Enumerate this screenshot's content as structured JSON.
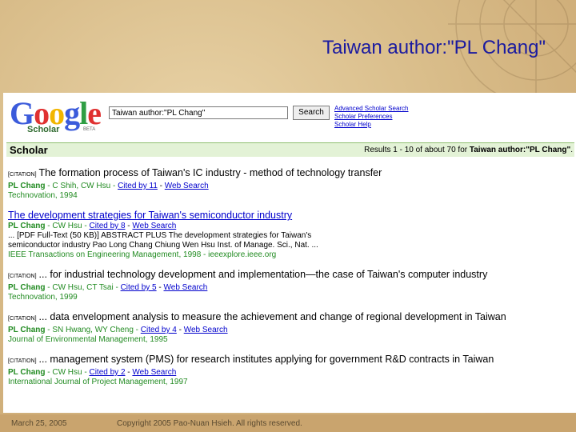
{
  "slide": {
    "title": "Taiwan author:\"PL Chang\"",
    "footer_date": "March 25, 2005",
    "footer_copyright": "Copyright 2005 Pao-Nuan Hsieh. All rights reserved."
  },
  "logo": {
    "letters": [
      "G",
      "o",
      "o",
      "g",
      "l",
      "e"
    ],
    "letter_colors": [
      "#3b5bdb",
      "#e03131",
      "#f2b600",
      "#3b5bdb",
      "#2f9e44",
      "#e03131"
    ],
    "sub": "Scholar",
    "beta": "BETA"
  },
  "search": {
    "value": "Taiwan author:\"PL Chang\"",
    "button": "Search"
  },
  "side_links": [
    "Advanced Scholar Search",
    "Scholar Preferences",
    "Scholar Help"
  ],
  "bar": {
    "label": "Scholar",
    "results_prefix": "Results 1 - 10 of about 70 for ",
    "results_query": "Taiwan author:\"PL Chang\"",
    "results_suffix": "."
  },
  "results": [
    {
      "tag": "[CITATION]",
      "title": "The formation process of Taiwan's IC industry - method of technology transfer",
      "authors": "PL Chang",
      "coauthors": " - C Shih, CW Hsu - ",
      "cited": "Cited by 11",
      "web": "Web Search",
      "lines": [],
      "source": "Technovation, 1994"
    },
    {
      "tag": "",
      "title": "The development strategies for Taiwan's semiconductor industry",
      "authors": "PL Chang",
      "coauthors": " - CW Hsu - ",
      "cited": "Cited by 8",
      "web": "Web Search",
      "lines": [
        "... [PDF Full-Text (50 KB)] ABSTRACT PLUS The development strategies for Taiwan's",
        "semiconductor industry Pao Long Chang Chiung Wen Hsu Inst. of Manage. Sci., Nat. ..."
      ],
      "source": "IEEE Transactions on Engineering Management, 1998 - ieeexplore.ieee.org"
    },
    {
      "tag": "[CITATION]",
      "title": "... for industrial technology development and implementation—the case of Taiwan's computer industry",
      "authors": "PL Chang",
      "coauthors": " - CW Hsu, CT Tsai - ",
      "cited": "Cited by 5",
      "web": "Web Search",
      "lines": [],
      "source": "Technovation, 1999"
    },
    {
      "tag": "[CITATION]",
      "title": "... data envelopment analysis to measure the achievement and change of regional development in Taiwan",
      "authors": "PL Chang",
      "coauthors": " - SN Hwang, WY Cheng - ",
      "cited": "Cited by 4",
      "web": "Web Search",
      "lines": [],
      "source": "Journal of Environmental Management, 1995"
    },
    {
      "tag": "[CITATION]",
      "title": "... management system (PMS) for research institutes applying for government R&D contracts in Taiwan",
      "authors": "PL Chang",
      "coauthors": " - CW Hsu - ",
      "cited": "Cited by 2",
      "web": "Web Search",
      "lines": [],
      "source": "International Journal of Project Management, 1997"
    }
  ]
}
